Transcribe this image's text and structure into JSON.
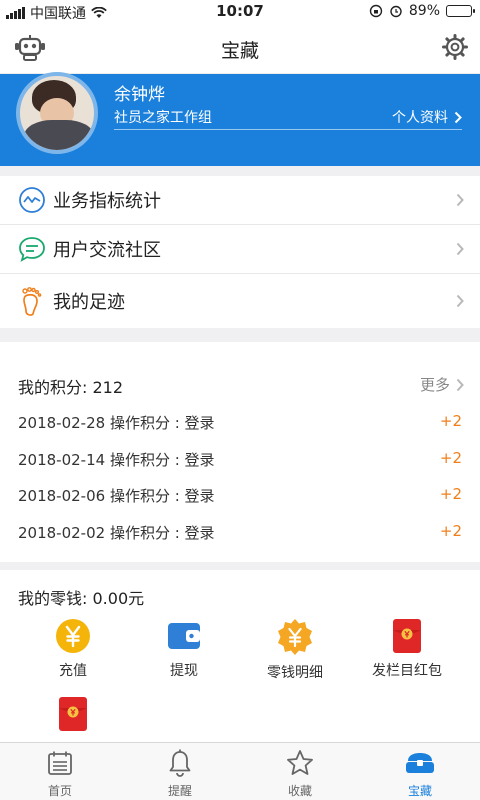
{
  "status_bar": {
    "carrier": "中国联通",
    "time": "10:07",
    "battery": "89%",
    "battery_level": 0.89
  },
  "nav": {
    "title": "宝藏",
    "left_icon": "robot-icon",
    "right_icon": "gear-icon"
  },
  "profile": {
    "name": "余钟烨",
    "group": "社员之家工作组",
    "info_link": "个人资料"
  },
  "menu": [
    {
      "label": "业务指标统计",
      "icon": "chart-icon",
      "color": "#2f7fd6"
    },
    {
      "label": "用户交流社区",
      "icon": "chat-bubble-icon",
      "color": "#1aa86e"
    },
    {
      "label": "我的足迹",
      "icon": "footprint-icon",
      "color": "#f07f1a"
    }
  ],
  "points": {
    "title": "我的积分:",
    "value": "212",
    "more": "更多",
    "records": [
      {
        "date": "2018-02-28",
        "desc": "操作积分 : 登录",
        "points": "+2"
      },
      {
        "date": "2018-02-14",
        "desc": "操作积分 : 登录",
        "points": "+2"
      },
      {
        "date": "2018-02-06",
        "desc": "操作积分 : 登录",
        "points": "+2"
      },
      {
        "date": "2018-02-02",
        "desc": "操作积分 : 登录",
        "points": "+2"
      }
    ]
  },
  "wallet": {
    "title": "我的零钱:",
    "amount": "0.00元",
    "items": [
      {
        "label": "充值",
        "icon": "yuan-coin-icon",
        "color": "#f5b40a"
      },
      {
        "label": "提现",
        "icon": "wallet-icon",
        "color": "#2f7fd6"
      },
      {
        "label": "零钱明细",
        "icon": "yuan-badge-icon",
        "color": "#f5a623"
      },
      {
        "label": "发栏目红包",
        "icon": "red-envelope-icon",
        "color": "#e02727"
      },
      {
        "label": "",
        "icon": "red-envelope-icon",
        "color": "#e02727"
      }
    ]
  },
  "tabs": [
    {
      "label": "首页",
      "icon": "calendar-icon"
    },
    {
      "label": "提醒",
      "icon": "bell-icon"
    },
    {
      "label": "收藏",
      "icon": "star-icon"
    },
    {
      "label": "宝藏",
      "icon": "treasure-icon",
      "active": true
    }
  ],
  "colors": {
    "accent": "#1a80dc",
    "points_plus": "#f07f1a"
  }
}
